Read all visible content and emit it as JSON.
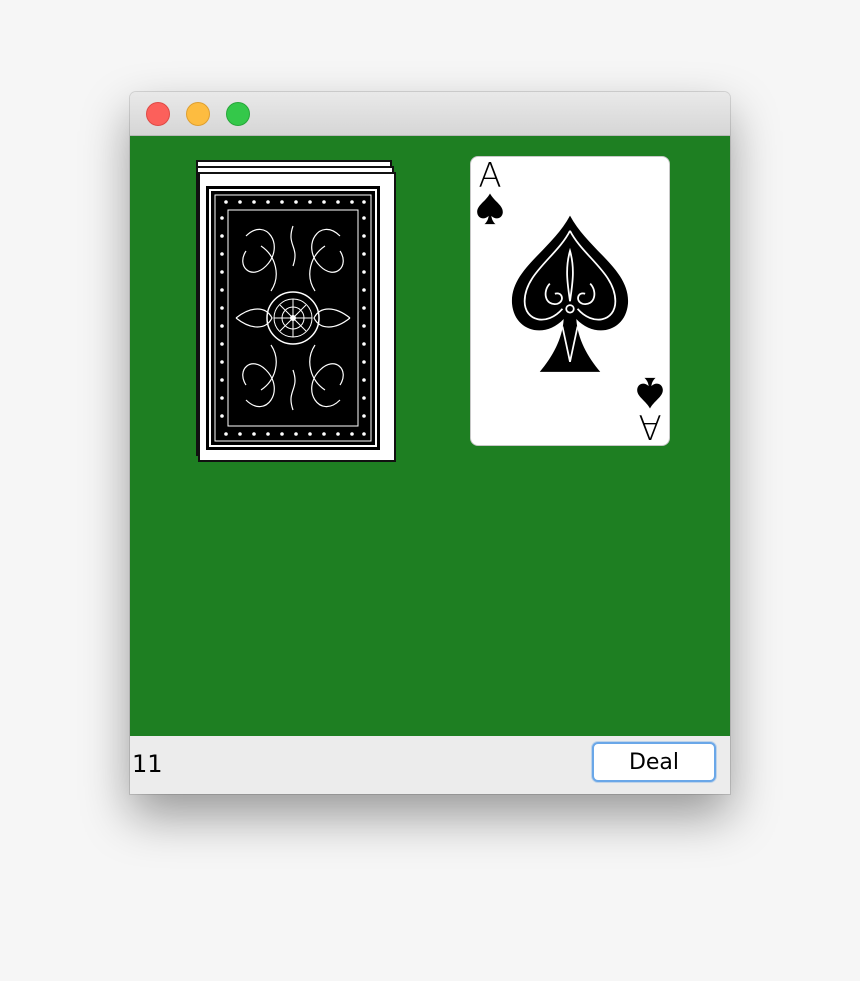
{
  "window": {
    "buttons": [
      "close",
      "minimize",
      "zoom"
    ]
  },
  "table": {
    "background_color": "#1e7f22",
    "deck": {
      "face": "back",
      "icon": "card-back-ornate-pattern"
    },
    "face_up_card": {
      "rank": "A",
      "suit": "spades",
      "suit_icon": "spade-icon",
      "color": "#000000"
    }
  },
  "status": {
    "count": "11",
    "deal_label": "Deal"
  },
  "colors": {
    "close": "#fc605b",
    "minimize": "#fdbc40",
    "zoom": "#34c84a",
    "button_focus": "#6aa7e8"
  }
}
